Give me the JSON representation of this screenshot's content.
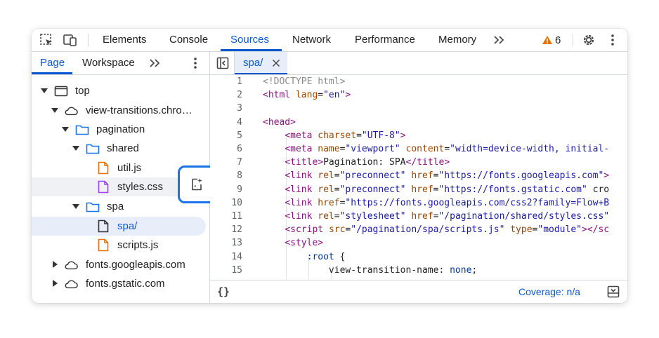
{
  "toolbar": {
    "tabs": [
      {
        "label": "Elements"
      },
      {
        "label": "Console"
      },
      {
        "label": "Sources"
      },
      {
        "label": "Network"
      },
      {
        "label": "Performance"
      },
      {
        "label": "Memory"
      }
    ],
    "active_tab": "Sources",
    "warning_count": "6"
  },
  "navigator": {
    "tabs": [
      {
        "label": "Page"
      },
      {
        "label": "Workspace"
      }
    ],
    "active_tab": "Page",
    "tree": [
      {
        "label": "top",
        "type": "frame",
        "expanded": true
      },
      {
        "label": "view-transitions.chro…",
        "type": "cloud",
        "expanded": true
      },
      {
        "label": "pagination",
        "type": "folder",
        "expanded": true
      },
      {
        "label": "shared",
        "type": "folder",
        "expanded": true
      },
      {
        "label": "util.js",
        "type": "js"
      },
      {
        "label": "styles.css",
        "type": "css"
      },
      {
        "label": "spa",
        "type": "folder",
        "expanded": true
      },
      {
        "label": "spa/",
        "type": "doc"
      },
      {
        "label": "scripts.js",
        "type": "js"
      },
      {
        "label": "fonts.googleapis.com",
        "type": "cloud",
        "expanded": false
      },
      {
        "label": "fonts.gstatic.com",
        "type": "cloud",
        "expanded": false
      }
    ]
  },
  "editor": {
    "open_tab": "spa/",
    "line_numbers": [
      "1",
      "2",
      "3",
      "4",
      "5",
      "6",
      "7",
      "8",
      "9",
      "10",
      "11",
      "12",
      "13",
      "14",
      "15"
    ],
    "lines": [
      "<!DOCTYPE html>",
      "<html lang=\"en\">",
      "",
      "<head>",
      "    <meta charset=\"UTF-8\">",
      "    <meta name=\"viewport\" content=\"width=device-width, initial-",
      "    <title>Pagination: SPA</title>",
      "    <link rel=\"preconnect\" href=\"https://fonts.googleapis.com\">",
      "    <link rel=\"preconnect\" href=\"https://fonts.gstatic.com\" cro",
      "    <link href=\"https://fonts.googleapis.com/css2?family=Flow+B",
      "    <link rel=\"stylesheet\" href=\"/pagination/shared/styles.css\"",
      "    <script src=\"/pagination/spa/scripts.js\" type=\"module\"></sc",
      "    <style>",
      "        :root {",
      "            view-transition-name: none;"
    ]
  },
  "statusbar": {
    "format_label": "{}",
    "coverage": "Coverage: n/a"
  },
  "colors": {
    "accent": "#0b57d0",
    "warning": "#e37400",
    "js_file": "#e8710a",
    "css_file": "#a142f4",
    "highlight_border": "#1a73e8"
  },
  "icons": {
    "inspect": "inspect-element-icon",
    "device": "device-toggle-icon",
    "more_tabs": "double-chevron-icon",
    "warning": "warning-icon",
    "settings": "gear-icon",
    "menu": "kebab-menu-icon",
    "toggle_navigator": "sidebar-toggle-icon",
    "close_tab": "close-icon",
    "new_file": "new-file-icon",
    "drawer": "drawer-toggle-icon"
  }
}
